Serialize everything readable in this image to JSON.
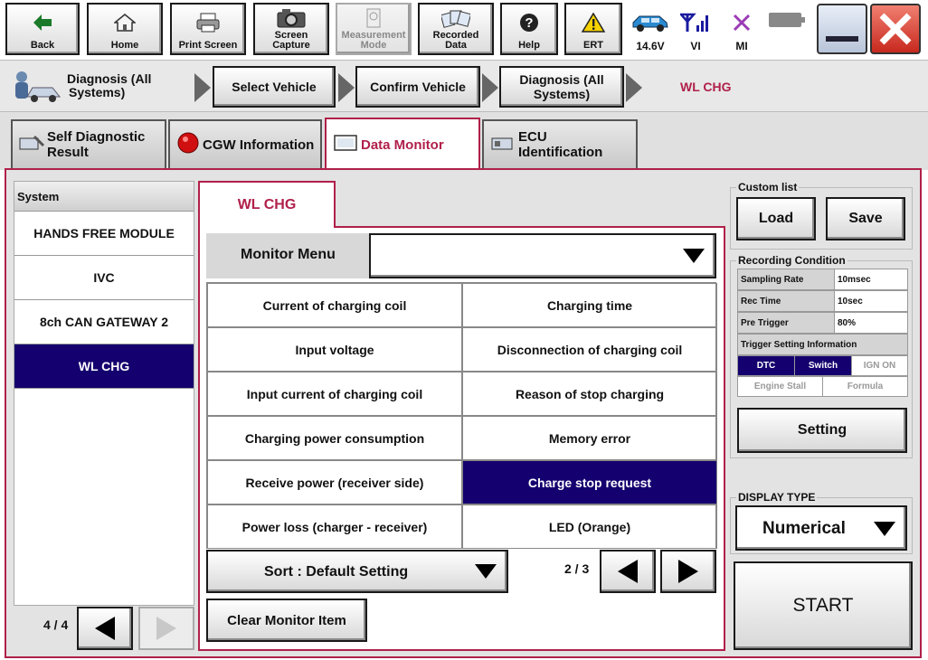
{
  "toolbar": {
    "back": "Back",
    "home": "Home",
    "print_screen": "Print Screen",
    "screen_capture_1": "Screen",
    "screen_capture_2": "Capture",
    "measurement_mode_1": "Measurement",
    "measurement_mode_2": "Mode",
    "recorded_data_1": "Recorded",
    "recorded_data_2": "Data",
    "help": "Help",
    "ert": "ERT",
    "battery_voltage": "14.6V",
    "vi": "VI",
    "mi": "MI"
  },
  "breadcrumb": {
    "root_1": "Diagnosis (All",
    "root_2": "Systems)",
    "select_vehicle": "Select Vehicle",
    "confirm_vehicle": "Confirm Vehicle",
    "diag_all_1": "Diagnosis (All",
    "diag_all_2": "Systems)",
    "current": "WL CHG"
  },
  "tabs": {
    "self_diag_1": "Self Diagnostic",
    "self_diag_2": "Result",
    "cgw_info": "CGW Information",
    "data_monitor": "Data Monitor",
    "ecu_id_1": "ECU",
    "ecu_id_2": "Identification"
  },
  "system_list": {
    "header": "System",
    "items": [
      "HANDS FREE MODULE",
      "IVC",
      "8ch CAN GATEWAY 2",
      "WL CHG"
    ],
    "selected": "WL CHG",
    "page": "4 / 4"
  },
  "center": {
    "tab_label": "WL CHG",
    "monitor_menu_label": "Monitor Menu",
    "monitor_menu_value": "",
    "items": [
      [
        "Current of charging coil",
        "Charging time"
      ],
      [
        "Input voltage",
        "Disconnection of charging coil"
      ],
      [
        "Input current of charging coil",
        "Reason of stop charging"
      ],
      [
        "Charging power consumption",
        "Memory error"
      ],
      [
        "Receive power (receiver side)",
        "Charge stop request"
      ],
      [
        "Power loss (charger - receiver)",
        "LED (Orange)"
      ]
    ],
    "selected_item": "Charge stop request",
    "sort_label": "Sort : Default Setting",
    "page": "2 / 3",
    "clear_button": "Clear Monitor Item"
  },
  "right": {
    "custom_list_label": "Custom list",
    "load": "Load",
    "save": "Save",
    "recording_condition_label": "Recording Condition",
    "sampling_rate_label": "Sampling Rate",
    "sampling_rate_value": "10msec",
    "rec_time_label": "Rec Time",
    "rec_time_value": "10sec",
    "pre_trigger_label": "Pre Trigger",
    "pre_trigger_value": "80%",
    "trigger_info_label": "Trigger Setting Information",
    "trig_dtc": "DTC",
    "trig_switch": "Switch",
    "trig_ign_on": "IGN ON",
    "trig_engine_stall": "Engine Stall",
    "trig_formula": "Formula",
    "setting": "Setting",
    "display_type_label": "DISPLAY TYPE",
    "display_type_value": "Numerical",
    "start": "START"
  },
  "colors": {
    "accent": "#b0204a",
    "selection": "#14006e",
    "close_red": "#d8413a"
  }
}
